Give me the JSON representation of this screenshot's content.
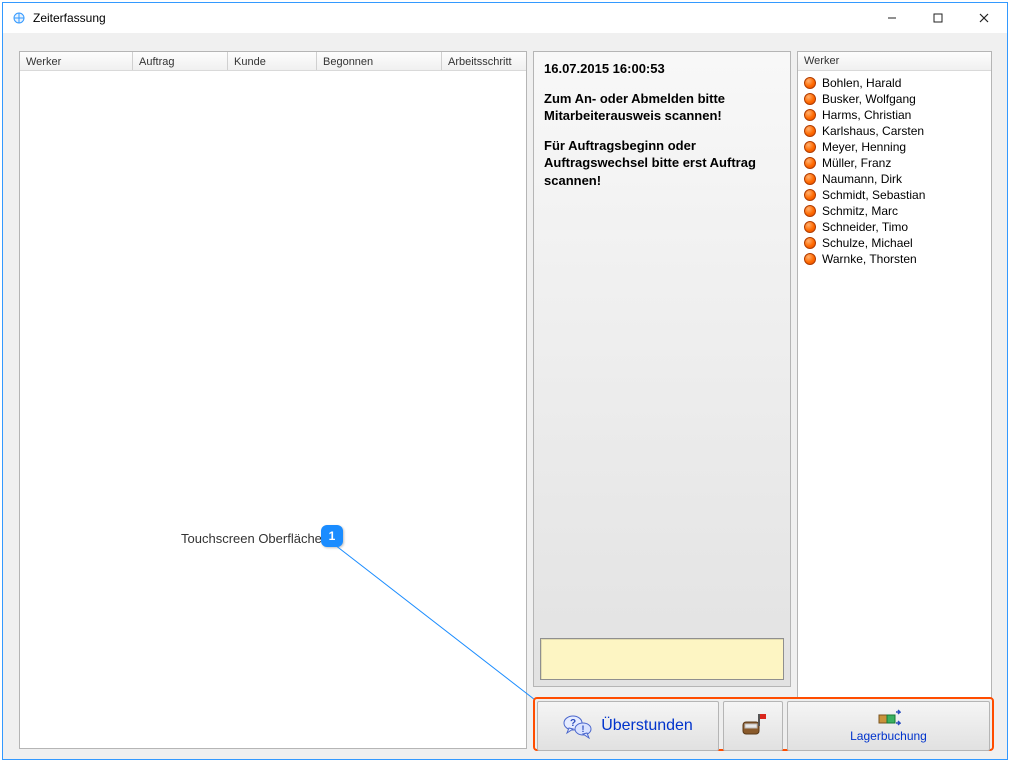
{
  "window": {
    "title": "Zeiterfassung"
  },
  "grid": {
    "columns": [
      "Werker",
      "Auftrag",
      "Kunde",
      "Begonnen",
      "Arbeitsschritt"
    ]
  },
  "callout": {
    "label": "Touchscreen Oberfläche",
    "number": "1"
  },
  "center": {
    "timestamp": "16.07.2015 16:00:53",
    "msg1": "Zum An- oder Abmelden bitte Mitarbeiterausweis scannen!",
    "msg2": "Für Auftragsbeginn oder Auftragswechsel bitte erst Auftrag scannen!"
  },
  "workers": {
    "header": "Werker",
    "items": [
      "Bohlen, Harald",
      "Busker, Wolfgang",
      "Harms, Christian",
      "Karlshaus, Carsten",
      "Meyer, Henning",
      "Müller, Franz",
      "Naumann, Dirk",
      "Schmidt, Sebastian",
      "Schmitz, Marc",
      "Schneider, Timo",
      "Schulze, Michael",
      "Warnke, Thorsten"
    ]
  },
  "toolbar": {
    "overtime_label": "Überstunden",
    "lager_label": "Lagerbuchung"
  }
}
